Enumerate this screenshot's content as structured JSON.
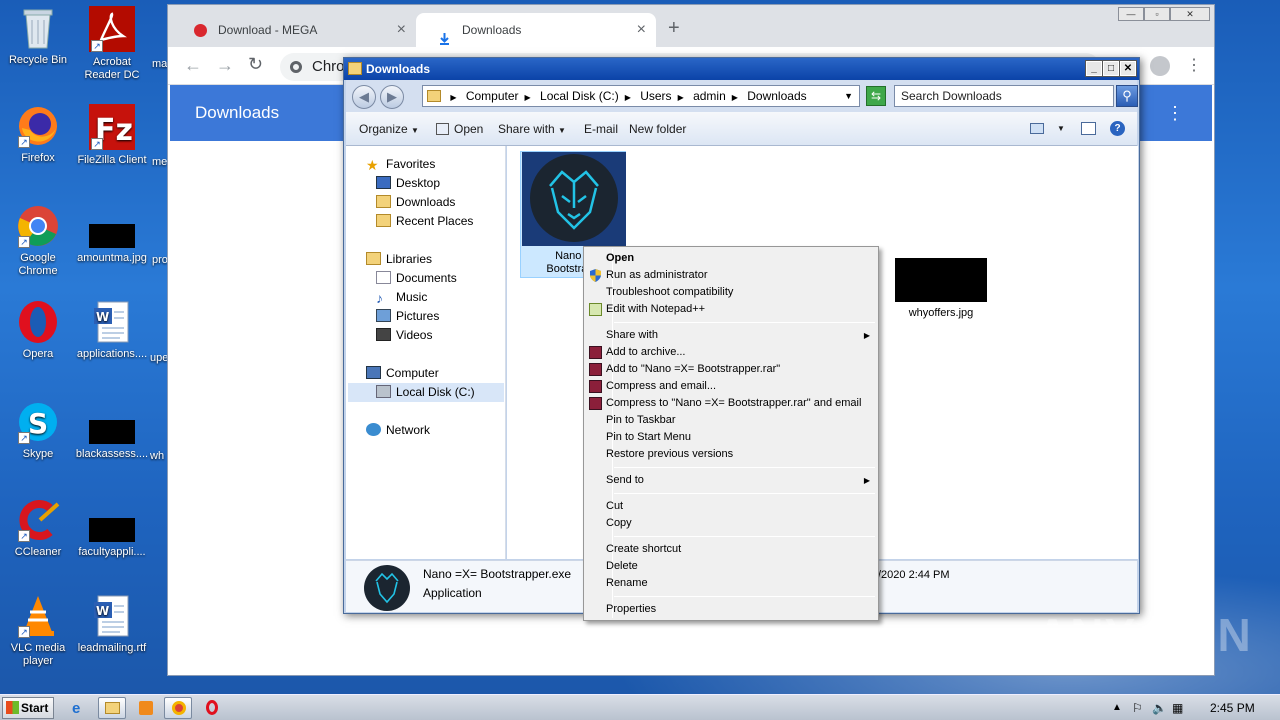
{
  "desktop": {
    "icons": [
      {
        "label": "Recycle Bin",
        "icon": "recycle-bin-icon"
      },
      {
        "label": "Acrobat Reader DC",
        "icon": "acrobat-icon"
      },
      {
        "label": "Firefox",
        "icon": "firefox-icon"
      },
      {
        "label": "FileZilla Client",
        "icon": "filezilla-icon"
      },
      {
        "label": "Google Chrome",
        "icon": "chrome-icon"
      },
      {
        "label": "amountma.jpg",
        "icon": "image-file-icon"
      },
      {
        "label": "Opera",
        "icon": "opera-icon"
      },
      {
        "label": "applications....",
        "icon": "word-doc-icon"
      },
      {
        "label": "Skype",
        "icon": "skype-icon"
      },
      {
        "label": "blackassess....",
        "icon": "image-file-icon"
      },
      {
        "label": "CCleaner",
        "icon": "ccleaner-icon"
      },
      {
        "label": "facultyappli....",
        "icon": "image-file-icon"
      },
      {
        "label": "VLC media player",
        "icon": "vlc-icon"
      },
      {
        "label": "leadmailing.rtf",
        "icon": "word-doc-icon"
      }
    ],
    "partial_labels": [
      "ma",
      "me",
      "pro",
      "upe",
      "wh"
    ]
  },
  "chrome": {
    "tabs": [
      {
        "label": "Download - MEGA",
        "icon": "mega-icon"
      },
      {
        "label": "Downloads",
        "icon": "download-icon"
      }
    ],
    "new_tab": "+",
    "omnibox_text": "Chro",
    "page_heading": "Downloads"
  },
  "explorer": {
    "title": "Downloads",
    "breadcrumb": [
      "Computer",
      "Local Disk (C:)",
      "Users",
      "admin",
      "Downloads"
    ],
    "search_placeholder": "Search Downloads",
    "commands": {
      "organize": "Organize",
      "open": "Open",
      "share_with": "Share with",
      "email": "E-mail",
      "new_folder": "New folder"
    },
    "nav": {
      "favorites": "Favorites",
      "desktop": "Desktop",
      "downloads": "Downloads",
      "recent_places": "Recent Places",
      "libraries": "Libraries",
      "documents": "Documents",
      "music": "Music",
      "pictures": "Pictures",
      "videos": "Videos",
      "computer": "Computer",
      "local_disk": "Local Disk (C:)",
      "network": "Network"
    },
    "files": [
      {
        "name_line1": "Nano =",
        "name_line2": "Bootstrapp"
      },
      {
        "name": ""
      },
      {
        "name": ""
      },
      {
        "name": "whyoffers.jpg"
      }
    ],
    "details": {
      "filename": "Nano =X= Bootstrapper.exe",
      "type": "Application",
      "date_fragment": "/2020 2:44 PM"
    }
  },
  "context_menu": {
    "items": [
      {
        "label": "Open",
        "bold": true
      },
      {
        "label": "Run as administrator",
        "icon": "uac-shield-icon"
      },
      {
        "label": "Troubleshoot compatibility"
      },
      {
        "label": "Edit with Notepad++",
        "icon": "notepadpp-icon"
      },
      {
        "label": "Share with",
        "submenu": true
      },
      {
        "label": "Add to archive...",
        "icon": "winrar-icon"
      },
      {
        "label": "Add to \"Nano =X= Bootstrapper.rar\"",
        "icon": "winrar-icon"
      },
      {
        "label": "Compress and email...",
        "icon": "winrar-icon"
      },
      {
        "label": "Compress to \"Nano =X= Bootstrapper.rar\" and email",
        "icon": "winrar-icon"
      },
      {
        "label": "Pin to Taskbar"
      },
      {
        "label": "Pin to Start Menu"
      },
      {
        "label": "Restore previous versions"
      },
      {
        "label": "Send to",
        "submenu": true
      },
      {
        "label": "Cut"
      },
      {
        "label": "Copy"
      },
      {
        "label": "Create shortcut"
      },
      {
        "label": "Delete"
      },
      {
        "label": "Rename"
      },
      {
        "label": "Properties"
      }
    ]
  },
  "taskbar": {
    "start": "Start",
    "clock": "2:45 PM",
    "pinned": [
      "ie-icon",
      "explorer-icon",
      "media-player-icon",
      "chrome-icon",
      "opera-icon"
    ]
  },
  "watermark": "ANY RUN",
  "colors": {
    "chrome_banner": "#3c78d8",
    "explorer_title": "#0b43a8",
    "selection": "#cce8ff"
  }
}
